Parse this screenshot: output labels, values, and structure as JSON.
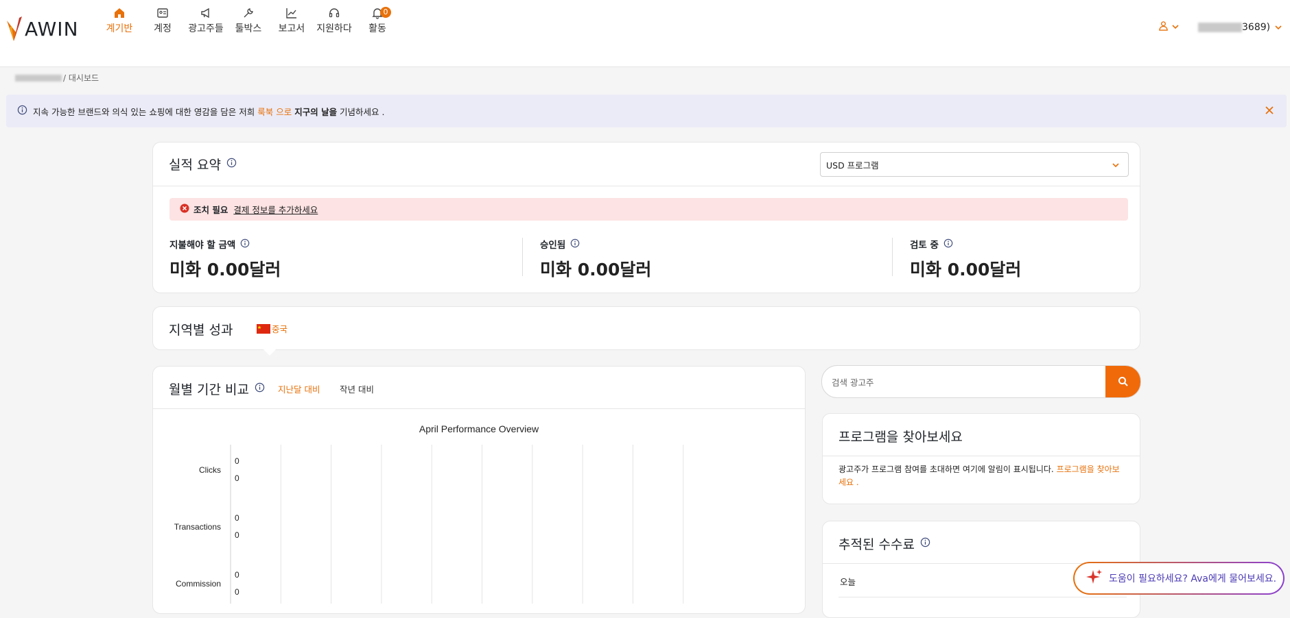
{
  "brand": {
    "name": "AWIN",
    "accent": "#e8710a"
  },
  "nav": [
    {
      "key": "dashboard",
      "label": "계기반",
      "icon": "home-icon",
      "active": true
    },
    {
      "key": "account",
      "label": "계정",
      "icon": "id-card-icon"
    },
    {
      "key": "advertisers",
      "label": "광고주들",
      "icon": "megaphone-icon"
    },
    {
      "key": "toolbox",
      "label": "툴박스",
      "icon": "wrench-icon"
    },
    {
      "key": "reports",
      "label": "보고서",
      "icon": "chart-line-icon"
    },
    {
      "key": "support",
      "label": "지원하다",
      "icon": "headset-icon"
    },
    {
      "key": "activity",
      "label": "활동",
      "icon": "bell-icon",
      "badge": "0"
    }
  ],
  "account": {
    "name_suffix": "3689)"
  },
  "breadcrumb": {
    "current": "/ 대시보드"
  },
  "banner": {
    "text_before": "지속 가능한 브랜드와 의식 있는 쇼핑에 대한 영감을 담은 저희 ",
    "link_text": "룩북 으로",
    "text_bold": "지구의 날을",
    "text_after": " 기념하세요 ."
  },
  "summary": {
    "title": "실적 요약",
    "program_select": "USD 프로그램",
    "alert_label": "조치 필요",
    "alert_link": "결제 정보를 추가하세요",
    "stats": [
      {
        "label": "지불해야 할 금액",
        "value": "미화 0.00달러"
      },
      {
        "label": "승인됨",
        "value": "미화 0.00달러"
      },
      {
        "label": "검토 중",
        "value": "미화 0.00달러"
      }
    ]
  },
  "regional": {
    "title": "지역별 성과",
    "country": "중국"
  },
  "monthly": {
    "title": "월별 기간 비교",
    "tabs": [
      "지난달 대비",
      "작년 대비"
    ],
    "active_tab": 0
  },
  "chart_data": {
    "type": "line",
    "title": "April Performance Overview",
    "series": [
      {
        "name": "Clicks",
        "values": [
          0,
          0
        ]
      },
      {
        "name": "Transactions",
        "values": [
          0,
          0
        ]
      },
      {
        "name": "Commission",
        "values": [
          0,
          0
        ]
      }
    ],
    "grid": true
  },
  "search": {
    "placeholder": "검색 광고주"
  },
  "find_programs": {
    "title": "프로그램을 찾아보세요",
    "body": "광고주가 프로그램 참여를 초대하면 여기에 알림이 표시됩니다. ",
    "link": "프로그램을 찾아보세요 ."
  },
  "tracked": {
    "title": "추적된 수수료",
    "row_label": "오늘"
  },
  "assistant": {
    "label": "도움이 필요하세요? Ava에게 물어보세요."
  }
}
